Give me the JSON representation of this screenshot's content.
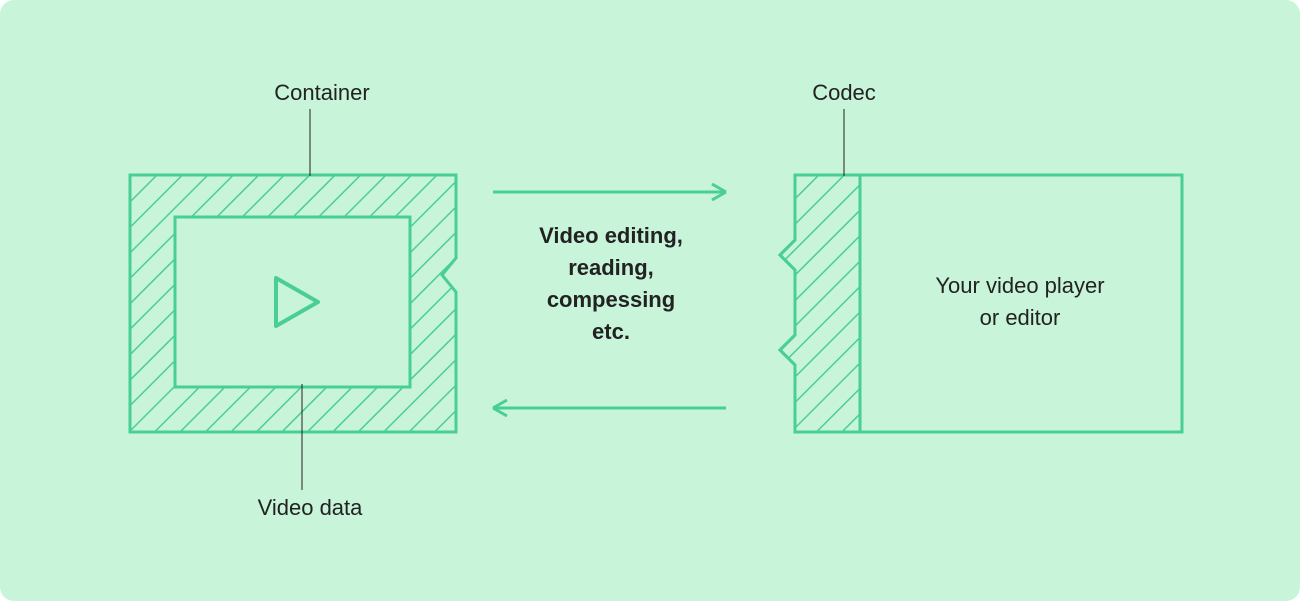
{
  "labels": {
    "container": "Container",
    "codec": "Codec",
    "video_data": "Video data"
  },
  "middle": {
    "line1": "Video editing,",
    "line2": "reading,",
    "line3": "compessing",
    "line4": "etc."
  },
  "player": {
    "line1": "Your video player",
    "line2": "or editor"
  },
  "colors": {
    "bg": "#c8f4da",
    "stroke": "#49cf94",
    "text": "#222222"
  }
}
